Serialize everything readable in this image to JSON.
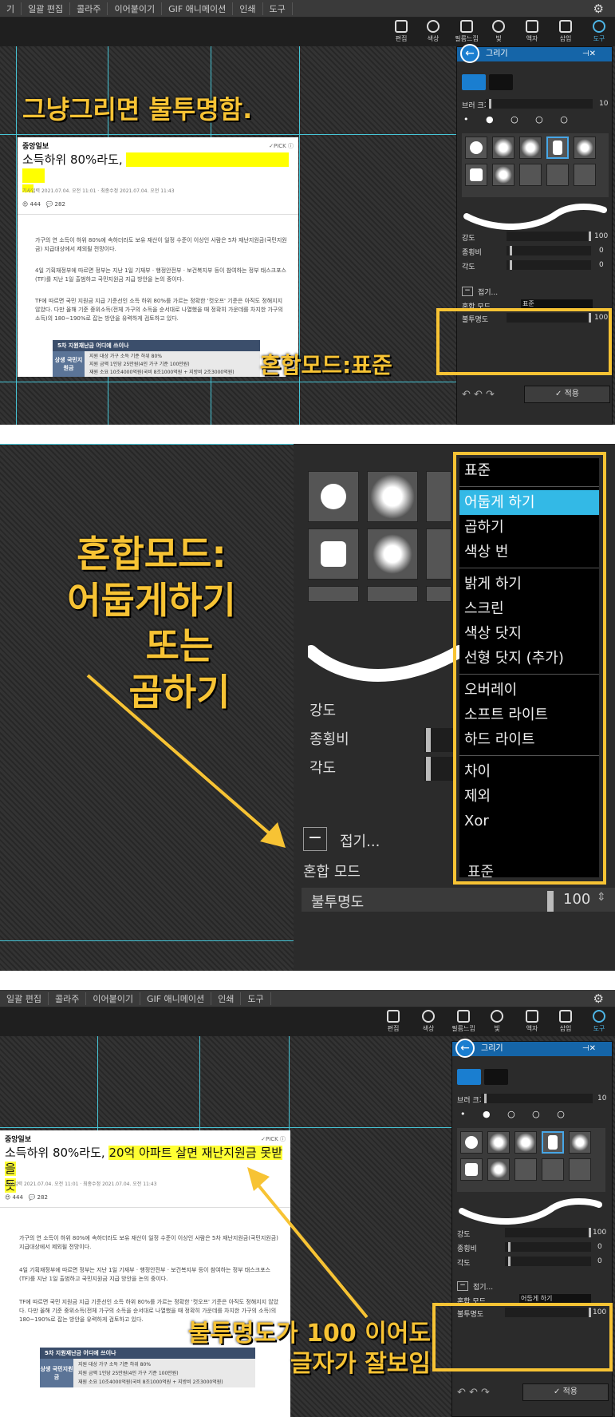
{
  "menu": [
    "기",
    "일괄 편집",
    "콜라주",
    "이어붙이기",
    "GIF 애니메이션",
    "인쇄",
    "도구"
  ],
  "menu3": [
    "일괄 편집",
    "콜라주",
    "이어붙이기",
    "GIF 애니메이션",
    "인쇄",
    "도구"
  ],
  "toolbar": [
    "편집",
    "색상",
    "필름느낌",
    "빛",
    "액자",
    "삽입",
    "도구"
  ],
  "panel_title": "그리기",
  "brush_size_label": "브러 크기",
  "brush_size_value": "10",
  "intensity_label": "강도",
  "intensity_value": "100",
  "aspect_label": "종횡비",
  "aspect_value": "0",
  "angle_label": "각도",
  "angle_value": "0",
  "fold_label": "접기...",
  "blend_label": "혼합 모드",
  "blend_value_1": "표준",
  "blend_value_3": "어둡게 하기",
  "opacity_label": "불투명도",
  "opacity_value": "100",
  "apply_label": "적용",
  "caption1": "그냥그리면 불투명함.",
  "caption1b": "혼합모드:표준",
  "caption2": [
    "혼합모드:",
    "어둡게하기",
    "또는",
    "곱하기"
  ],
  "caption3": [
    "불투명도가 100 이어도",
    "글자가 잘보임"
  ],
  "article": {
    "brand": "중앙일보",
    "pick": "✓PICK ⓘ",
    "headline_pre": "소득하위 80%라도, ",
    "headline_hl": "20억 아파트 살면 재난지원금 못받을",
    "headline_post": "듯",
    "meta": "기사입력 2021.07.04. 오전 11:01 · 최종수정 2021.07.04. 오전 11:43",
    "likes": "444",
    "comments": "282",
    "para1": "가구의 연 소득이 하위 80%에 속하더라도 보유 재산이 일정 수준이 이상인 사람은 5차 재난지원금(국민지원금) 지급대상에서 제외될 전망이다.",
    "para2": "4일 기획재정부에 따르면 정부는 지난 1일 기재부 · 행정안전부 · 보건복지부 등이 참여하는 정부 태스크포스(TF)를 지난 1일 출범하고 국민지원금 지급 방안을 논의 중이다.",
    "para3": "TF에 따르면 국민 지원금 지급 기준선인 소득 하위 80%를 가르는 정확한 '컷오프' 기준은 아직도 정해지지 않았다. 다만 올해 기준 중위소득(전체 가구의 소득을 순서대로 나열했을 때 정확히 가운데를 차지한 가구의 소득)의 180~190%로 잡는 방안을 유력하게 검토하고 있다.",
    "table_title": "5차 지원재난금 어디에 쓰이나",
    "table_side": "상생 국민지원금",
    "table_rows": [
      "지원 대상  가구 소득 기준 하위 80%",
      "지원 금액  1인당 25만원(4인 가구 기준 100만원)",
      "재원 소요  10조4000억원(국비 8조1000억원 + 지방비 2조3000억원)"
    ]
  },
  "dropdown": [
    "표준",
    "어둡게 하기",
    "곱하기",
    "색상 번",
    "밝게 하기",
    "스크린",
    "색상 닷지",
    "선형 닷지 (추가)",
    "오버레이",
    "소프트 라이트",
    "하드 라이트",
    "차이",
    "제외",
    "Xor"
  ],
  "colors": {
    "accent": "#47c5d6",
    "yellow": "#f7c334",
    "blue": "#1565a8",
    "select": "#33b9e6"
  }
}
